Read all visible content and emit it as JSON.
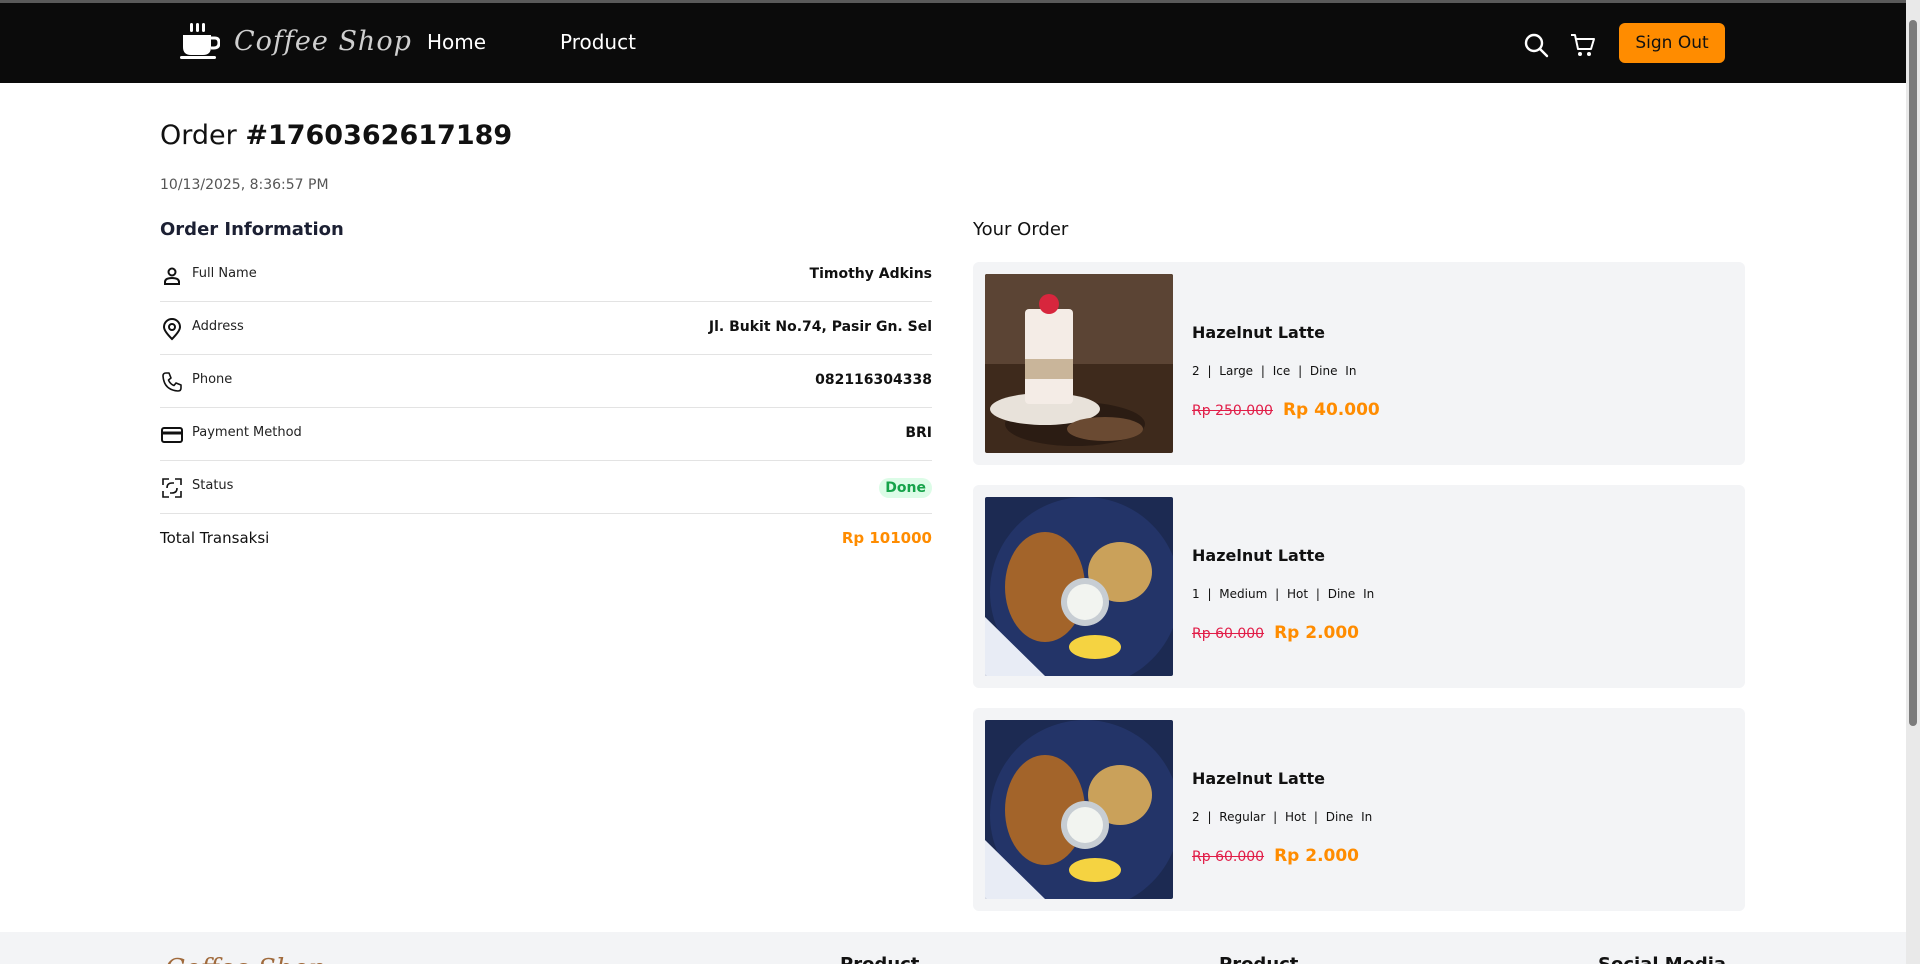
{
  "navbar": {
    "logo_text": "Coffee Shop",
    "links": [
      "Home",
      "Product"
    ],
    "search_icon": "search-icon",
    "cart_icon": "cart-icon",
    "signout_label": "Sign Out",
    "accent": "#ff8c00"
  },
  "order": {
    "label": "Order",
    "number": "#1760362617189",
    "date": "10/13/2025, 8:36:57 PM"
  },
  "info": {
    "heading": "Order Information",
    "rows": [
      {
        "icon": "person-icon",
        "label": "Full Name",
        "value": "Timothy Adkins"
      },
      {
        "icon": "location-pin-icon",
        "label": "Address",
        "value": "Jl. Bukit No.74, Pasir Gn. Sel"
      },
      {
        "icon": "phone-icon",
        "label": "Phone",
        "value": "082116304338"
      },
      {
        "icon": "credit-card-icon",
        "label": "Payment Method",
        "value": "BRI"
      },
      {
        "icon": "status-arrows-icon",
        "label": "Status",
        "value": "Done"
      }
    ],
    "total_label": "Total Transaksi",
    "total_value": "Rp 101000"
  },
  "your_order": {
    "heading": "Your Order",
    "items": [
      {
        "name": "Hazelnut Latte",
        "options": "2 | Large | Ice | Dine In",
        "old_price": "Rp 250.000",
        "new_price": "Rp 40.000",
        "image": "dessert-drink-photo"
      },
      {
        "name": "Hazelnut Latte",
        "options": "1 | Medium | Hot | Dine In",
        "old_price": "Rp 60.000",
        "new_price": "Rp 2.000",
        "image": "fried-food-plate-photo"
      },
      {
        "name": "Hazelnut Latte",
        "options": "2 | Regular | Hot | Dine In",
        "old_price": "Rp 60.000",
        "new_price": "Rp 2.000",
        "image": "fried-food-plate-photo"
      }
    ]
  },
  "footer": {
    "logo_text": "Coffee Shop",
    "columns": [
      "Product",
      "Product",
      "Social Media"
    ]
  }
}
